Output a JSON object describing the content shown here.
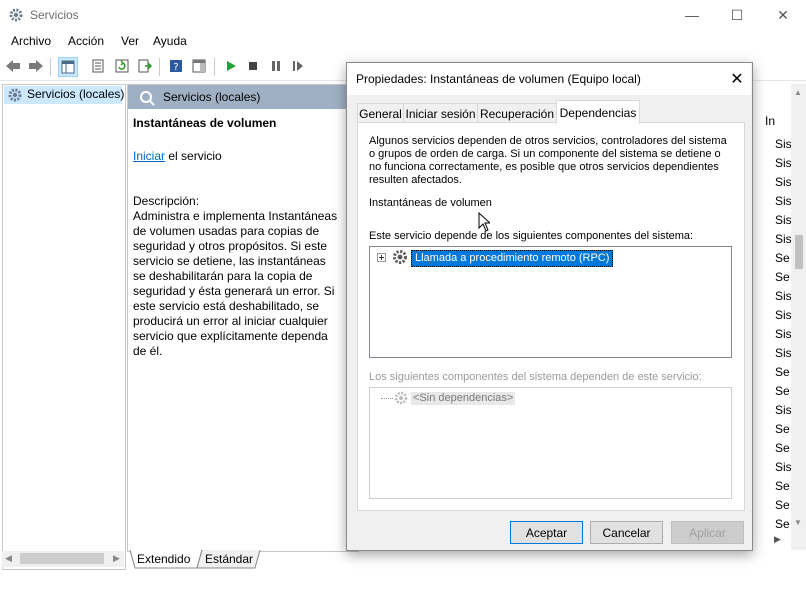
{
  "window": {
    "title": "Servicios"
  },
  "menu": [
    "Archivo",
    "Acción",
    "Ver",
    "Ayuda"
  ],
  "tree": {
    "root_label": "Servicios (locales)"
  },
  "middle": {
    "header": "Servicios (locales)",
    "service_name": "Instantáneas de volumen",
    "start_link": "Iniciar",
    "start_suffix": " el servicio",
    "description_label": "Descripción:",
    "description": "Administra e implementa Instantáneas de volumen usadas para copias de seguridad y otros propósitos. Si este servicio se detiene, las instantáneas se deshabilitarán para la copia de seguridad y ésta generará un error. Si este servicio está deshabilitado, se producirá un error al iniciar cualquier servicio que explícitamente dependa de él."
  },
  "list": {
    "header_partial": "In",
    "rows": [
      "Sis",
      "Sis",
      "Sis",
      "Sis",
      "Sis",
      "Sis",
      "Se",
      "Se",
      "Sis",
      "Sis",
      "Sis",
      "Sis",
      "Se",
      "Se",
      "Sis",
      "Se",
      "Se",
      "Sis",
      "Se",
      "Se",
      "Se"
    ]
  },
  "bottom_tabs": [
    "Extendido",
    "Estándar"
  ],
  "dialog": {
    "title": "Propiedades: Instantáneas de volumen (Equipo local)",
    "tabs": [
      "General",
      "Iniciar sesión",
      "Recuperación",
      "Dependencias"
    ],
    "active_tab": "Dependencias",
    "intro": "Algunos servicios dependen de otros servicios, controladores del sistema o grupos de orden de carga. Si un componente del sistema se detiene o no funciona correctamente, es posible que otros servicios dependientes resulten afectados.",
    "service_name": "Instantáneas de volumen",
    "depends_on_label": "Este servicio depende de los siguientes componentes del sistema:",
    "depends_on_items": [
      "Llamada a procedimiento remoto (RPC)"
    ],
    "dependents_label": "Los siguientes componentes del sistema dependen de este servicio:",
    "dependents_items": [
      "<Sin dependencias>"
    ],
    "buttons": {
      "ok": "Aceptar",
      "cancel": "Cancelar",
      "apply": "Aplicar"
    }
  }
}
